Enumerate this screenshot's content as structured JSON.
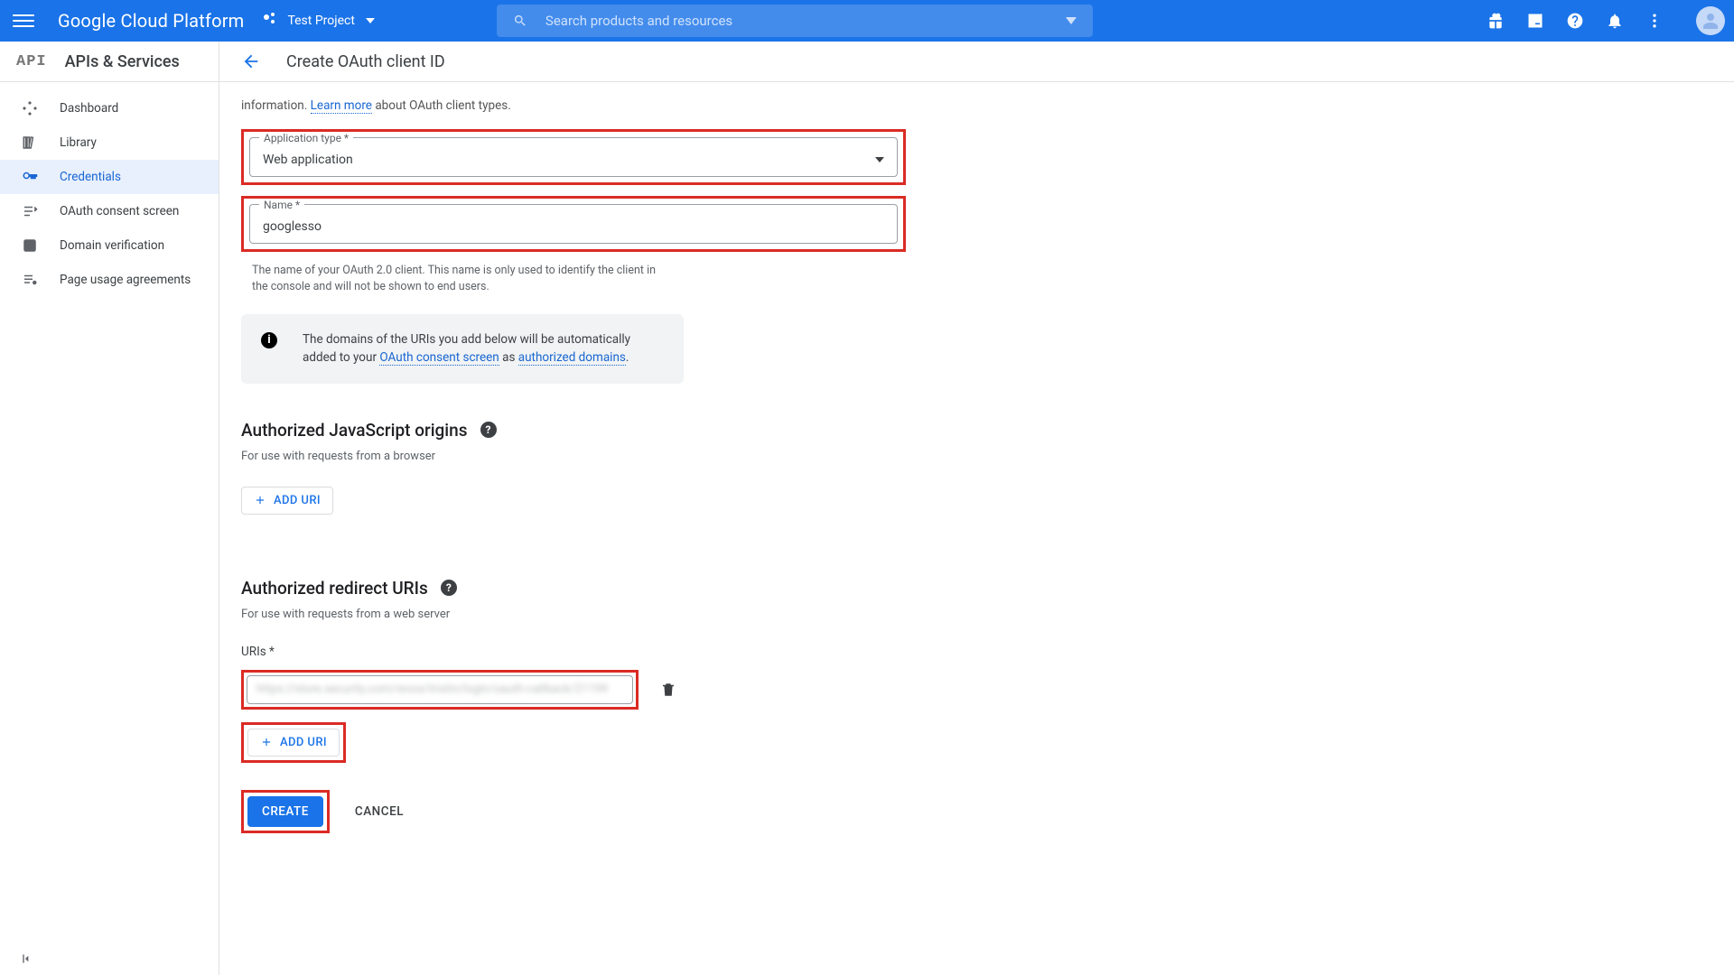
{
  "header": {
    "brand": "Google Cloud Platform",
    "project": "Test Project",
    "search_placeholder": "Search products and resources"
  },
  "sidebar": {
    "badge": "API",
    "title": "APIs & Services",
    "items": [
      {
        "label": "Dashboard"
      },
      {
        "label": "Library"
      },
      {
        "label": "Credentials"
      },
      {
        "label": "OAuth consent screen"
      },
      {
        "label": "Domain verification"
      },
      {
        "label": "Page usage agreements"
      }
    ],
    "active_index": 2
  },
  "page": {
    "title": "Create OAuth client ID",
    "intro_tail": "information. ",
    "learn_more": "Learn more",
    "intro_after_link": " about OAuth client types.",
    "app_type": {
      "label": "Application type *",
      "value": "Web application"
    },
    "name": {
      "label": "Name *",
      "value": "googlesso",
      "helper": "The name of your OAuth 2.0 client. This name is only used to identify the client in the console and will not be shown to end users."
    },
    "info": {
      "pre": "The domains of the URIs you add below will be automatically added to your ",
      "link1": "OAuth consent screen",
      "mid": " as ",
      "link2": "authorized domains",
      "post": "."
    },
    "js_origins": {
      "title": "Authorized JavaScript origins",
      "desc": "For use with requests from a browser",
      "add": "ADD URI"
    },
    "redirect": {
      "title": "Authorized redirect URIs",
      "desc": "For use with requests from a web server",
      "uris_label": "URIs *",
      "uri_value": "https://store.security.com/revox/tristin/login/oauth-callback/21199",
      "add": "ADD URI"
    },
    "actions": {
      "create": "CREATE",
      "cancel": "CANCEL"
    }
  }
}
